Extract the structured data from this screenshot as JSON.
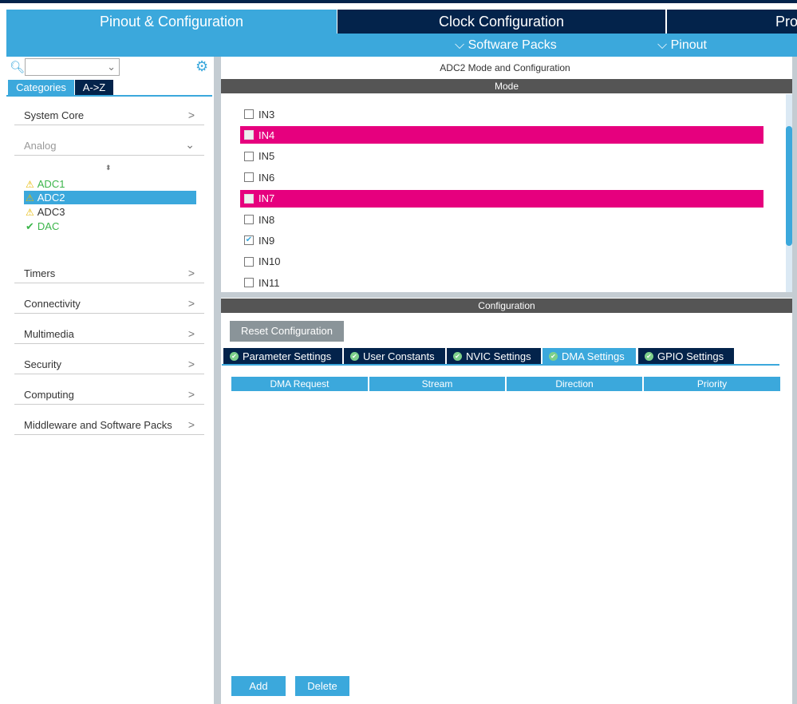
{
  "top_tabs": [
    {
      "label": "Pinout & Configuration",
      "active": true
    },
    {
      "label": "Clock Configuration",
      "active": false
    },
    {
      "label": "Pro",
      "active": false
    }
  ],
  "sub_menu": {
    "software_packs": "Software Packs",
    "pinout": "Pinout"
  },
  "left": {
    "search_value": "",
    "view_tabs": [
      "Categories",
      "A->Z"
    ],
    "categories": [
      "System Core",
      "Analog",
      "Timers",
      "Connectivity",
      "Multimedia",
      "Security",
      "Computing",
      "Middleware and Software Packs"
    ],
    "analog_items": [
      {
        "label": "ADC1",
        "status": "warning",
        "selected": false
      },
      {
        "label": "ADC2",
        "status": "warning",
        "selected": true
      },
      {
        "label": "ADC3",
        "status": "warning",
        "selected": false
      },
      {
        "label": "DAC",
        "status": "ok",
        "selected": false
      }
    ]
  },
  "main": {
    "title": "ADC2 Mode and Configuration",
    "mode_header": "Mode",
    "mode_items": [
      {
        "label": "IN3",
        "checked": false,
        "highlight": false
      },
      {
        "label": "IN4",
        "checked": false,
        "highlight": true
      },
      {
        "label": "IN5",
        "checked": false,
        "highlight": false
      },
      {
        "label": "IN6",
        "checked": false,
        "highlight": false
      },
      {
        "label": "IN7",
        "checked": false,
        "highlight": true
      },
      {
        "label": "IN8",
        "checked": false,
        "highlight": false
      },
      {
        "label": "IN9",
        "checked": true,
        "highlight": false
      },
      {
        "label": "IN10",
        "checked": false,
        "highlight": false
      },
      {
        "label": "IN11",
        "checked": false,
        "highlight": false
      }
    ],
    "config_header": "Configuration",
    "reset_label": "Reset Configuration",
    "config_tabs": [
      "Parameter Settings",
      "User Constants",
      "NVIC Settings",
      "DMA Settings",
      "GPIO Settings"
    ],
    "active_tab": "DMA Settings",
    "dma_columns": [
      "DMA Request",
      "Stream",
      "Direction",
      "Priority"
    ],
    "dma_rows": [],
    "add_label": "Add",
    "delete_label": "Delete"
  },
  "colors": {
    "accent": "#3ba8dc",
    "navy": "#03234b",
    "highlight": "#e6007e"
  }
}
